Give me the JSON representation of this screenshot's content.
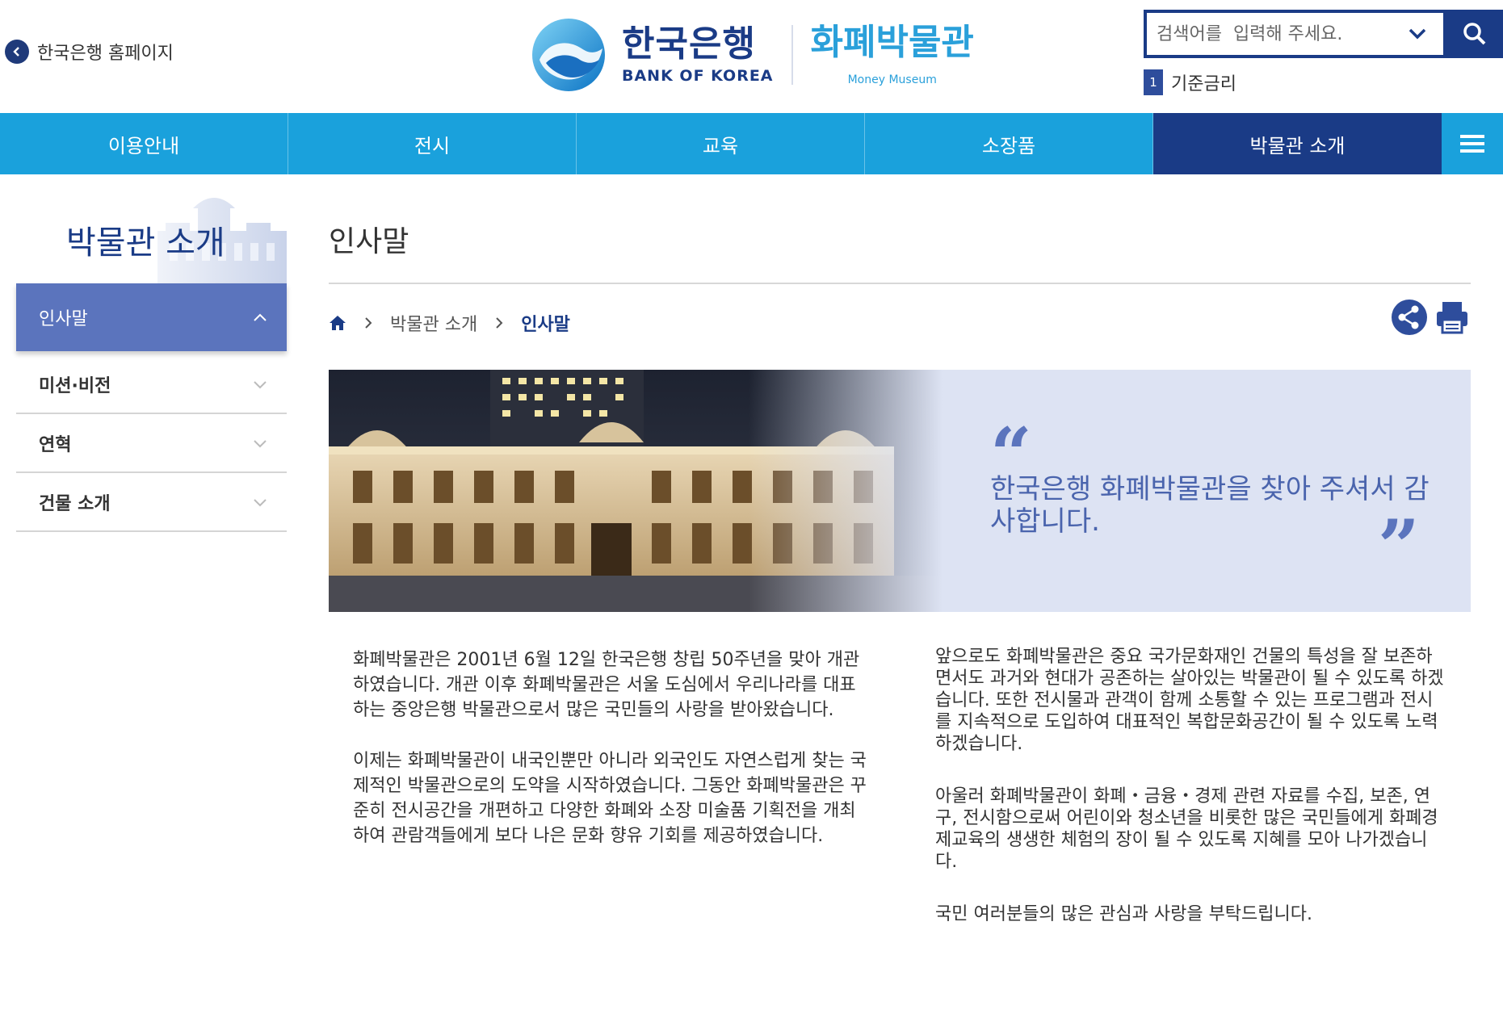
{
  "header": {
    "home_link": "한국은행 홈페이지",
    "logo_ko": "한국은행",
    "logo_en": "BANK OF KOREA",
    "museum_ko": "화폐박물관",
    "museum_en": "Money Museum",
    "search_placeholder": "검색어를  입력해 주세요.",
    "keyword_rank": "1",
    "keyword": "기준금리"
  },
  "nav": {
    "items": [
      "이용안내",
      "전시",
      "교육",
      "소장품",
      "박물관 소개"
    ],
    "active_index": 4
  },
  "sidebar": {
    "title": "박물관 소개",
    "items": [
      "인사말",
      "미션·비전",
      "연혁",
      "건물 소개"
    ],
    "active_index": 0
  },
  "main": {
    "title": "인사말",
    "breadcrumb": [
      "박물관 소개",
      "인사말"
    ],
    "banner_quote": "한국은행 화폐박물관을 찾아 주셔서 감사합니다.",
    "paragraphs_left": [
      "화폐박물관은 2001년 6월 12일 한국은행 창립 50주년을  맞아 개관하였습니다. 개관 이후 화폐박물관은 서울 도심에서 우리나라를 대표하는 중앙은행 박물관으로서 많은 국민들의 사랑을 받아왔습니다.",
      "이제는 화폐박물관이 내국인뿐만 아니라 외국인도 자연스럽게 찾는 국제적인 박물관으로의 도약을 시작하였습니다. 그동안 화폐박물관은 꾸준히 전시공간을 개편하고 다양한 화폐와 소장 미술품 기획전을 개최하여 관람객들에게 보다 나은 문화 향유 기회를 제공하였습니다."
    ],
    "paragraphs_right": [
      "앞으로도 화폐박물관은 중요 국가문화재인 건물의 특성을 잘 보존하면서도 과거와 현대가 공존하는 살아있는 박물관이 될 수 있도록 하겠습니다. 또한 전시물과 관객이 함께 소통할 수 있는 프로그램과 전시를 지속적으로 도입하여 대표적인 복합문화공간이 될 수 있도록 노력하겠습니다.",
      "아울러 화폐박물관이 화폐・금융・경제 관련 자료를 수집, 보존, 연구, 전시함으로써 어린이와 청소년을 비롯한 많은 국민들에게 화폐경제교육의 생생한 체험의 장이 될 수 있도록 지혜를 모아 나가겠습니다.",
      "국민 여러분들의 많은 관심과 사랑을 부탁드립니다."
    ]
  },
  "colors": {
    "brand_navy": "#1a3b86",
    "nav_blue": "#1aa1dc",
    "sidebar_active": "#5b74bd",
    "quote_text": "#4a64ad"
  }
}
